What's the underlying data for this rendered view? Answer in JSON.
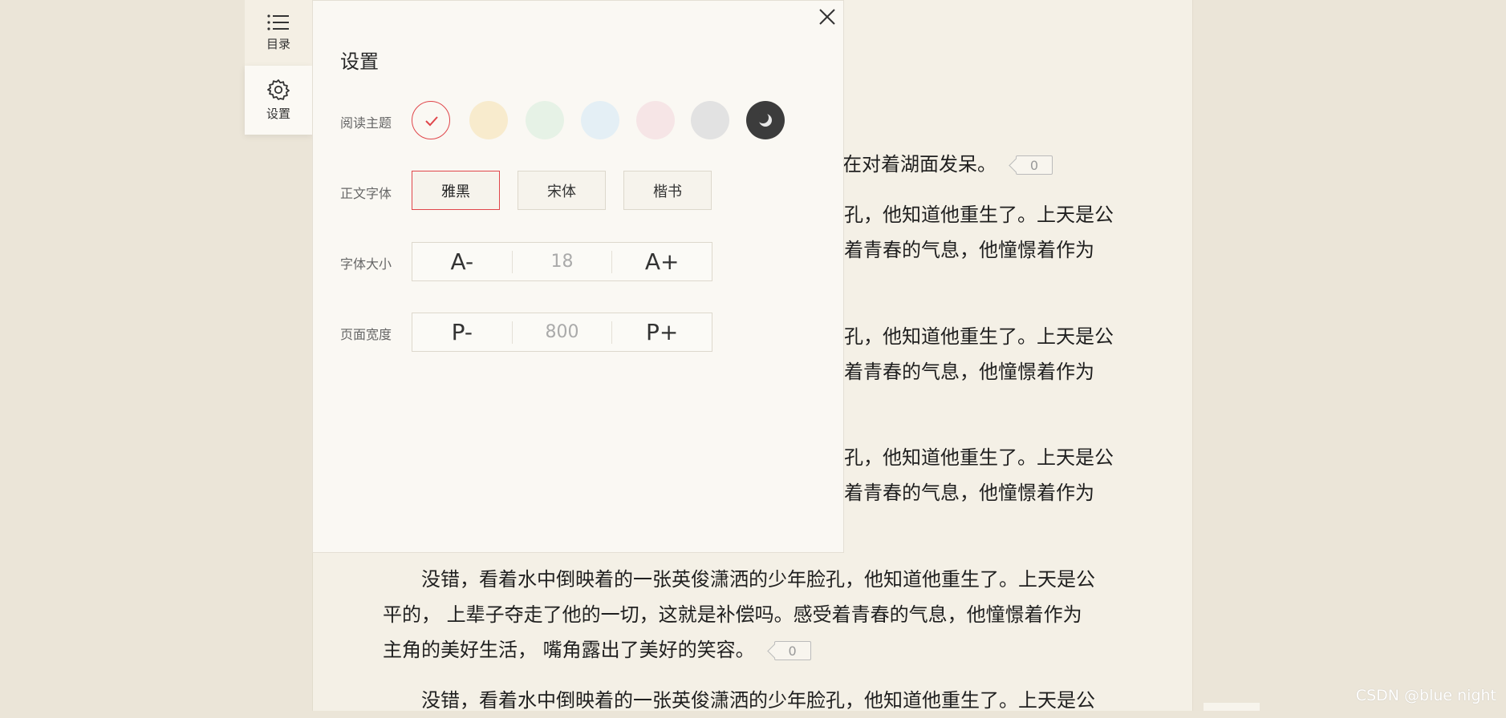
{
  "sidebar": {
    "items": [
      {
        "label": "目录",
        "icon": "list-icon"
      },
      {
        "label": "设置",
        "icon": "gear-icon"
      }
    ]
  },
  "reader": {
    "paragraphs": [
      {
        "lines": [
          "在对着湖面发呆。"
        ],
        "comments": "0"
      },
      {
        "lines": [
          "孔，他知道他重生了。上天是公",
          "着青春的气息，他憧憬着作为"
        ]
      },
      {
        "lines": [
          "孔，他知道他重生了。上天是公",
          "着青春的气息，他憧憬着作为"
        ]
      },
      {
        "lines": [
          "孔，他知道他重生了。上天是公",
          "着青春的气息，他憧憬着作为"
        ]
      },
      {
        "lines": [
          "　　没错，看着水中倒映着的一张英俊潇洒的少年脸孔，他知道他重生了。上天是公",
          "平的， 上辈子夺走了他的一切，这就是补偿吗。感受着青春的气息，他憧憬着作为",
          "主角的美好生活， 嘴角露出了美好的笑容。"
        ],
        "comments": "0"
      },
      {
        "lines": [
          "　　没错，看着水中倒映着的一张英俊潇洒的少年脸孔，他知道他重生了。上天是公"
        ]
      }
    ]
  },
  "settings": {
    "title": "设置",
    "theme_label": "阅读主题",
    "themes": [
      "#faf8f3",
      "#f8ebcd",
      "#e6f2e6",
      "#e4eff5",
      "#f6e5e6",
      "#e2e2e2",
      "#3c3c3c"
    ],
    "accent": "#e0464b",
    "font_label": "正文字体",
    "fonts": [
      "雅黑",
      "宋体",
      "楷书"
    ],
    "size_label": "字体大小",
    "size_minus": "A-",
    "size_value": "18",
    "size_plus": "A+",
    "width_label": "页面宽度",
    "width_minus": "P-",
    "width_value": "800",
    "width_plus": "P+"
  },
  "watermark": "CSDN @blue night"
}
